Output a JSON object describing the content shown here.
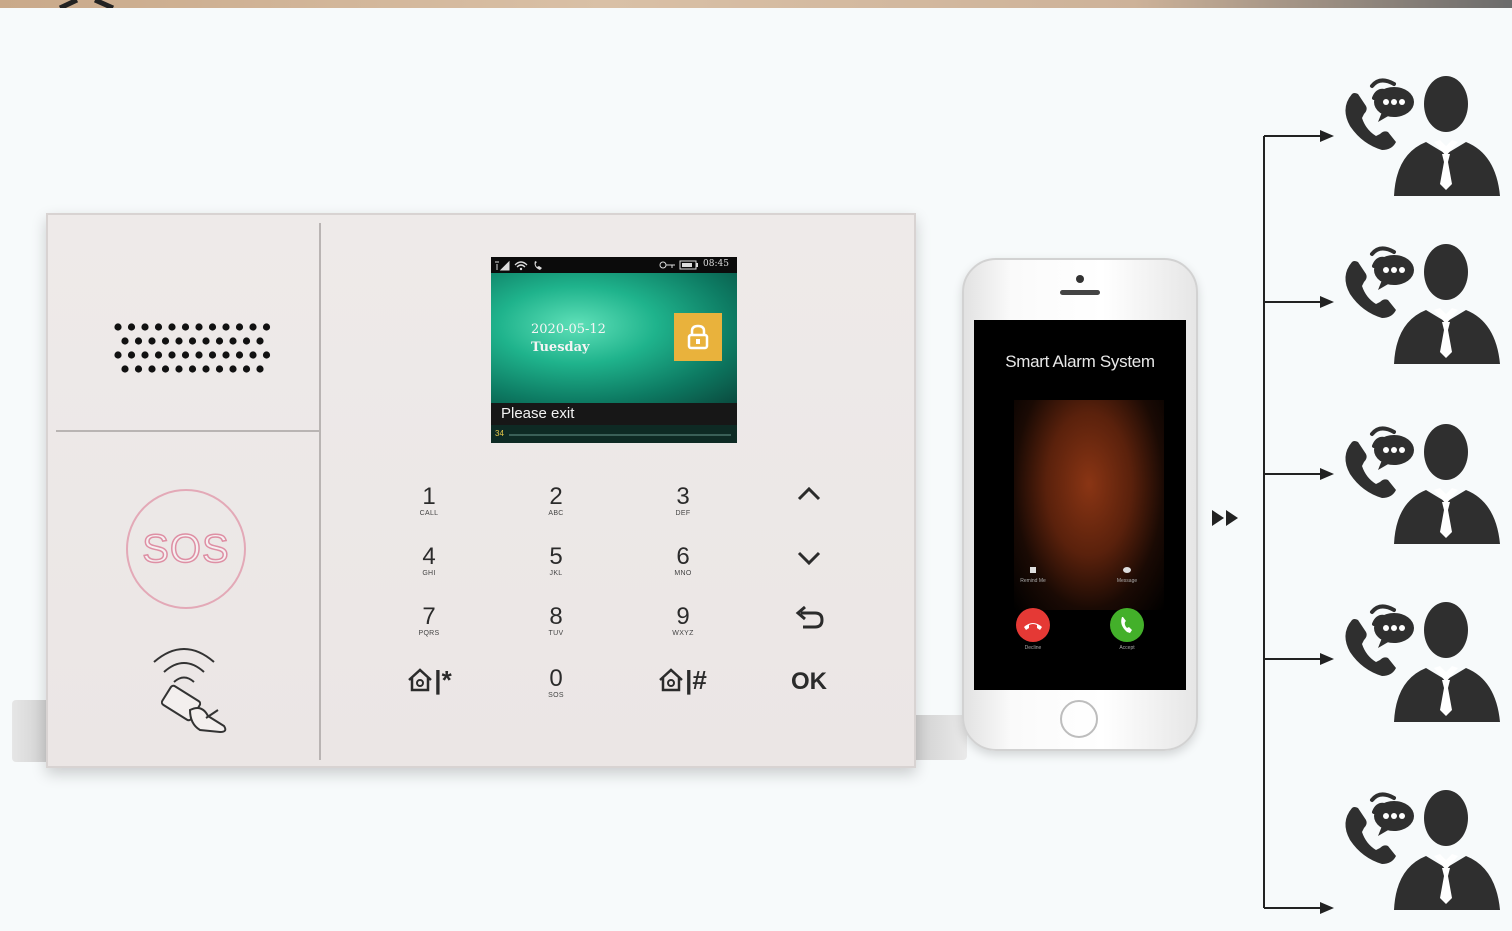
{
  "lcd": {
    "date": "2020-05-12",
    "day": "Tuesday",
    "time": "08:45",
    "message": "Please exit",
    "countdown": "34"
  },
  "panel": {
    "sos_label": "SOS"
  },
  "keypad": {
    "keys": [
      {
        "num": "1",
        "sub": "CALL"
      },
      {
        "num": "2",
        "sub": "ABC"
      },
      {
        "num": "3",
        "sub": "DEF"
      },
      {
        "num": "4",
        "sub": "GHI"
      },
      {
        "num": "5",
        "sub": "JKL"
      },
      {
        "num": "6",
        "sub": "MNO"
      },
      {
        "num": "7",
        "sub": "PQRS"
      },
      {
        "num": "8",
        "sub": "TUV"
      },
      {
        "num": "9",
        "sub": "WXYZ"
      },
      {
        "num": "0",
        "sub": "SOS"
      }
    ],
    "star_label": "|*",
    "hash_label": "|#",
    "ok_label": "OK"
  },
  "phone": {
    "call_title": "Smart Alarm System",
    "remind_label": "Remind Me",
    "message_label": "Message",
    "decline_label": "Decline",
    "accept_label": "Accept"
  },
  "icons": {
    "contact": "person-call-icon",
    "forward": "double-arrow-icon"
  },
  "colors": {
    "lcd_accent": "#1fb38c",
    "lock_tile": "#e9b23c",
    "sos_ring": "#de8fa4",
    "decline": "#e53935",
    "accept": "#43b02a",
    "contact_icon": "#2f2f2f"
  }
}
